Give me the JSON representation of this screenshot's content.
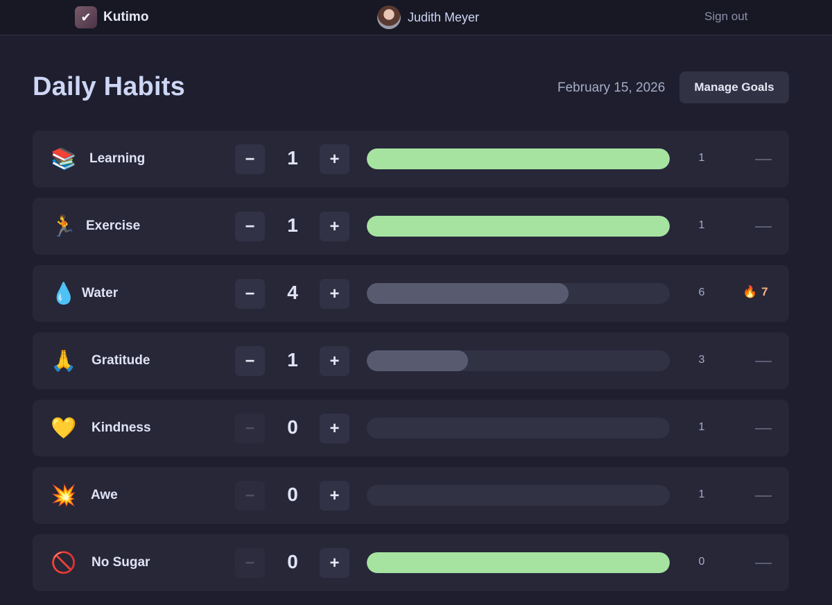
{
  "app": {
    "name": "Kutimo",
    "logo_icon": "flame-check-icon"
  },
  "user": {
    "name": "Judith Meyer"
  },
  "nav": {
    "signout_label": "Sign out"
  },
  "page": {
    "title": "Daily Habits",
    "date": "February 15, 2026",
    "manage_label": "Manage Goals"
  },
  "colors": {
    "fill_complete": "#a6e3a1",
    "fill_partial": "#585b70",
    "streak": "#fab387"
  },
  "habits": [
    {
      "name": "Learning",
      "icon": "books-icon",
      "glyph": "📚",
      "count": "1",
      "goal": "1",
      "progress": 1.0,
      "streak": "—",
      "minus_enabled": true
    },
    {
      "name": "Exercise",
      "icon": "runner-icon",
      "glyph": "🏃",
      "count": "1",
      "goal": "1",
      "progress": 1.0,
      "streak": "—",
      "minus_enabled": true
    },
    {
      "name": "Water",
      "icon": "water-drop-icon",
      "glyph": "💧",
      "count": "4",
      "goal": "6",
      "progress": 0.667,
      "streak": "7",
      "streak_icon": "fire-icon",
      "minus_enabled": true
    },
    {
      "name": "Gratitude",
      "icon": "folded-hands-icon",
      "glyph": "🙏",
      "count": "1",
      "goal": "3",
      "progress": 0.333,
      "streak": "—",
      "minus_enabled": true
    },
    {
      "name": "Kindness",
      "icon": "yellow-heart-icon",
      "glyph": "💛",
      "count": "0",
      "goal": "1",
      "progress": 0,
      "streak": "—",
      "minus_enabled": false
    },
    {
      "name": "Awe",
      "icon": "sparkle-star-icon",
      "glyph": "💥",
      "count": "0",
      "goal": "1",
      "progress": 0,
      "streak": "—",
      "minus_enabled": false
    },
    {
      "name": "No Sugar",
      "icon": "prohibited-icon",
      "glyph": "🚫",
      "count": "0",
      "goal": "0",
      "progress": 1.0,
      "streak": "—",
      "minus_enabled": false
    }
  ],
  "controls": {
    "minus_label": "−",
    "plus_label": "+"
  }
}
